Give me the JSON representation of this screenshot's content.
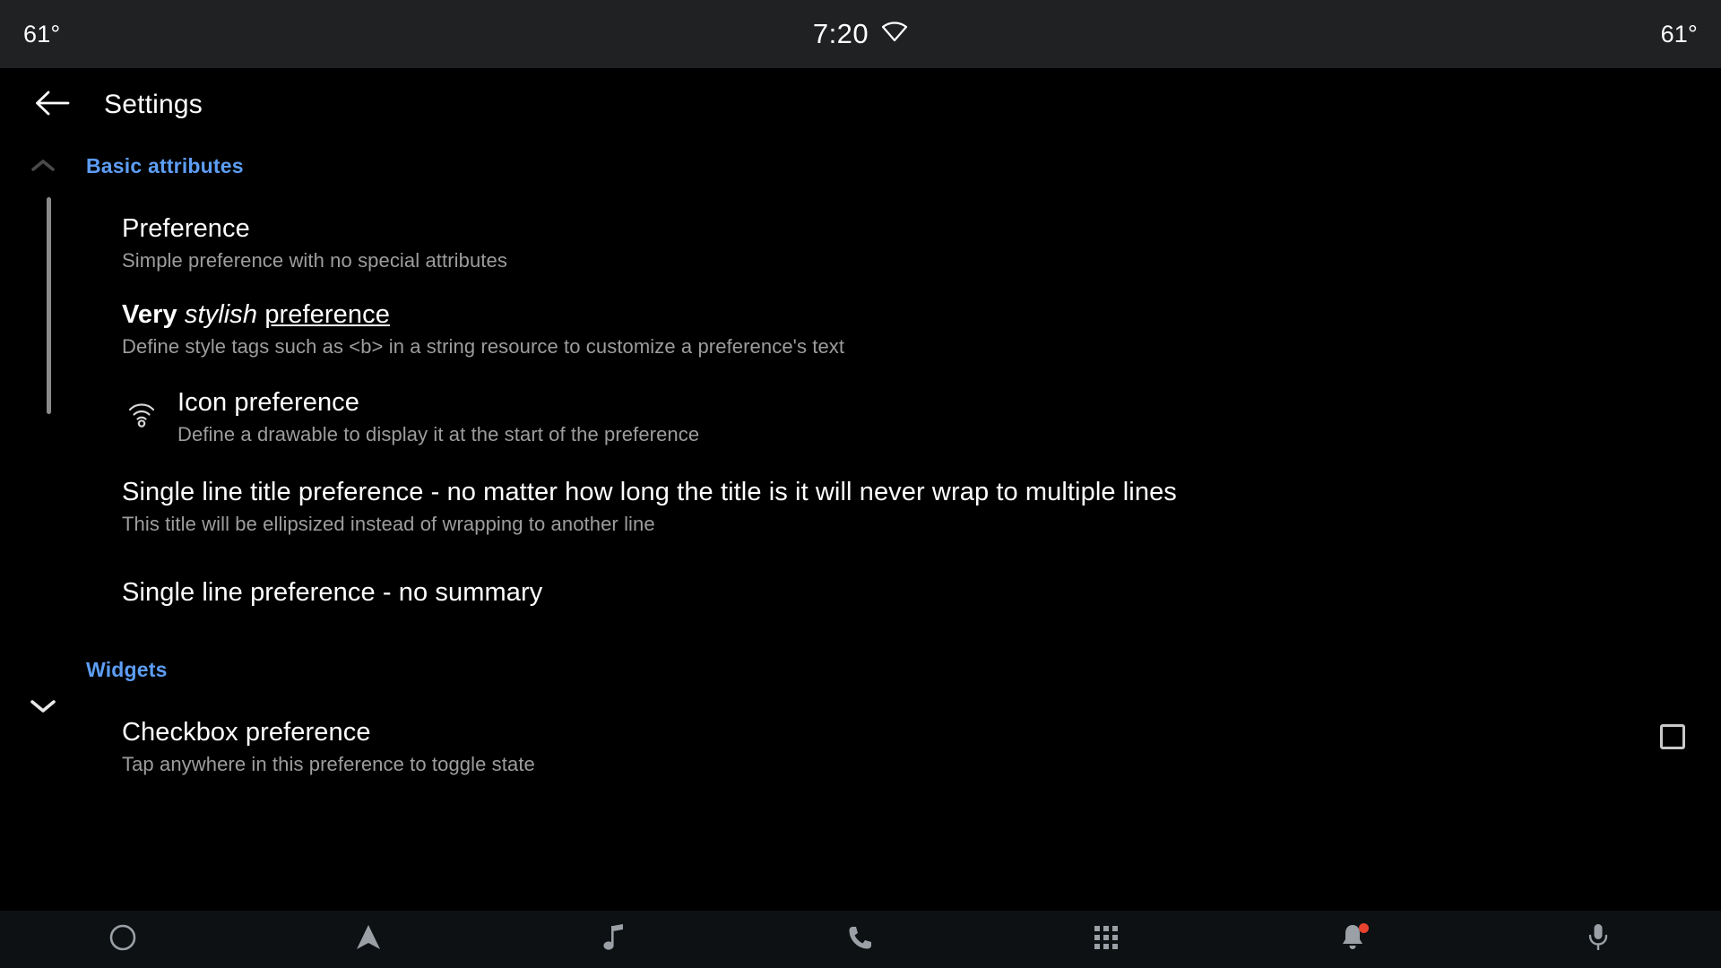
{
  "status_bar": {
    "temp_left": "61°",
    "temp_right": "61°",
    "time": "7:20",
    "wifi_icon": "wifi-icon"
  },
  "app_bar": {
    "back_icon": "back-arrow-icon",
    "title": "Settings"
  },
  "colors": {
    "accent_blue": "#5d9df5",
    "background": "#000000",
    "status_bar_bg": "#1f2123",
    "nav_bar_bg": "#0e1113",
    "title_text": "#ffffff",
    "summary_text": "#9d9d9d",
    "badge_red": "#e8432f"
  },
  "sections": [
    {
      "label": "Basic attributes",
      "chevron_icon": "chevron-up-icon",
      "preferences": [
        {
          "title": "Preference",
          "summary": "Simple preference with no special attributes",
          "icon": null,
          "widget": null
        },
        {
          "title_bold": "Very",
          "title_italic": "stylish",
          "title_underline": "preference",
          "summary": "Define style tags such as <b> in a string resource to customize a preference's text",
          "icon": null,
          "widget": null
        },
        {
          "title": "Icon preference",
          "summary": "Define a drawable to display it at the start of the preference",
          "icon": "wifi-icon",
          "widget": null
        },
        {
          "title": "Single line title preference - no matter how long the title is it will never wrap to multiple lines",
          "summary": "This title will be ellipsized instead of wrapping to another line",
          "icon": null,
          "widget": null
        },
        {
          "title": "Single line preference - no summary",
          "summary": null,
          "icon": null,
          "widget": null
        }
      ]
    },
    {
      "label": "Widgets",
      "chevron_icon": null,
      "preferences": [
        {
          "title": "Checkbox preference",
          "summary": "Tap anywhere in this preference to toggle state",
          "icon": null,
          "widget": "checkbox",
          "widget_checked": false
        }
      ]
    }
  ],
  "scroll_down_icon": "chevron-down-icon",
  "nav_bar": {
    "items": [
      {
        "icon": "home-circle-icon"
      },
      {
        "icon": "navigation-arrow-icon"
      },
      {
        "icon": "music-note-icon"
      },
      {
        "icon": "phone-icon"
      },
      {
        "icon": "apps-grid-icon"
      },
      {
        "icon": "bell-icon",
        "badge": true
      },
      {
        "icon": "microphone-icon"
      }
    ]
  }
}
